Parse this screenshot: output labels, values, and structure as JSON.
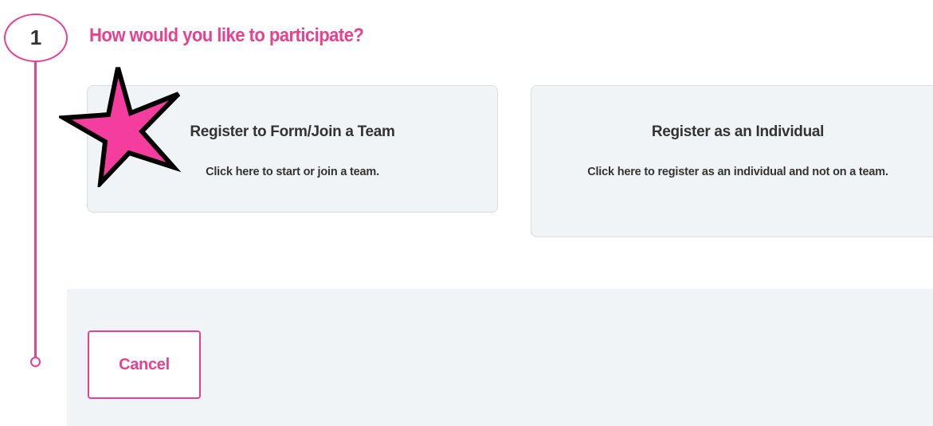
{
  "step": {
    "number": "1",
    "question": "How would you like to participate?"
  },
  "options": [
    {
      "title": "Register to Form/Join a Team",
      "description": "Click here to start or join a team."
    },
    {
      "title": "Register as an Individual",
      "description": "Click here to register as an individual and not on a team."
    }
  ],
  "actions": {
    "cancel_label": "Cancel"
  },
  "colors": {
    "accent": "#e8418e",
    "star_fill": "#f53da0",
    "card_background": "#f1f4f7",
    "text": "#333333"
  },
  "icons": {
    "highlight": "star-icon"
  }
}
